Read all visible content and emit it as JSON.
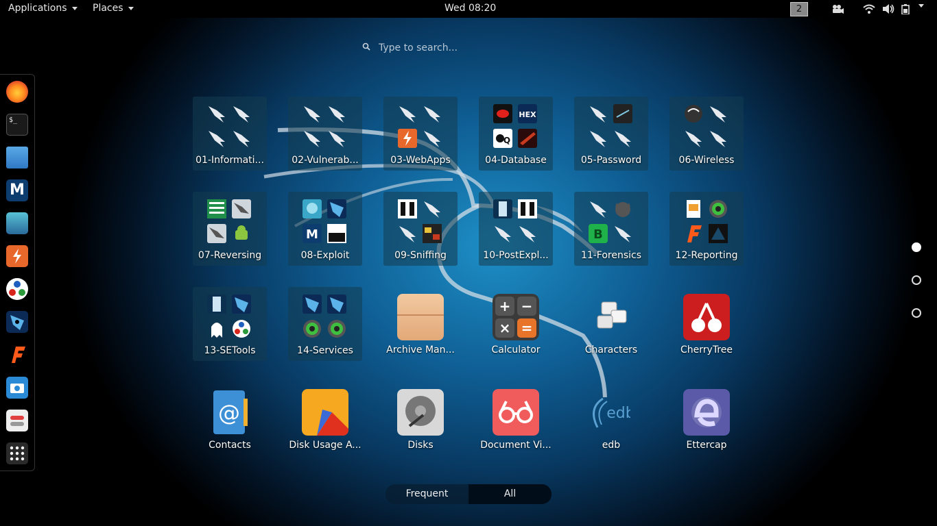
{
  "topbar": {
    "applications": "Applications",
    "places": "Places",
    "clock": "Wed 08:20",
    "workspace": "2"
  },
  "search": {
    "placeholder": "Type to search..."
  },
  "dash": {
    "items": [
      "firefox-icon",
      "terminal-icon",
      "files-icon",
      "metasploit-icon",
      "armitage-icon",
      "burpsuite-icon",
      "maltego-icon",
      "beef-icon",
      "faraday-icon",
      "screenshot-icon",
      "settings-icon",
      "show-apps-icon"
    ]
  },
  "grid": [
    {
      "label": "01-Informati..."
    },
    {
      "label": "02-Vulnerab..."
    },
    {
      "label": "03-WebApps"
    },
    {
      "label": "04-Database"
    },
    {
      "label": "05-Password"
    },
    {
      "label": "06-Wireless"
    },
    {
      "label": "07-Reversing"
    },
    {
      "label": "08-Exploit"
    },
    {
      "label": "09-Sniffing"
    },
    {
      "label": "10-PostExpl..."
    },
    {
      "label": "11-Forensics"
    },
    {
      "label": "12-Reporting"
    },
    {
      "label": "13-SETools"
    },
    {
      "label": "14-Services"
    },
    {
      "label": "Archive Man..."
    },
    {
      "label": "Calculator"
    },
    {
      "label": "Characters"
    },
    {
      "label": "CherryTree"
    },
    {
      "label": "Contacts"
    },
    {
      "label": "Disk Usage A..."
    },
    {
      "label": "Disks"
    },
    {
      "label": "Document Vi..."
    },
    {
      "label": "edb"
    },
    {
      "label": "Ettercap"
    }
  ],
  "calculator": {
    "plus": "+",
    "minus": "−",
    "times": "×",
    "equals": "="
  },
  "edb_logo": "edb",
  "pager": {
    "pages": 3,
    "current": 1
  },
  "switch": {
    "frequent": "Frequent",
    "all": "All",
    "active": "All"
  },
  "colors": {
    "accent": "#1d8fc6",
    "panel": "#000000"
  }
}
